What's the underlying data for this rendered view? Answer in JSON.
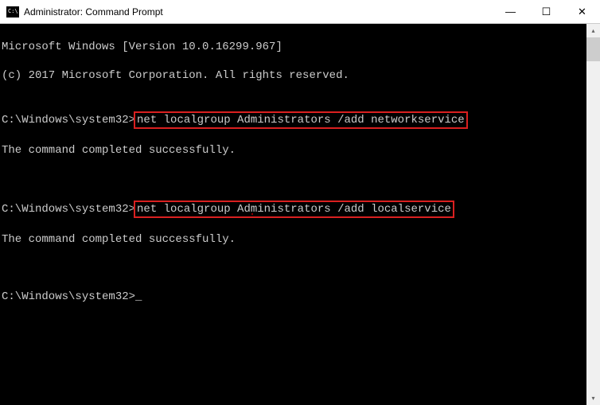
{
  "window": {
    "title": "Administrator: Command Prompt"
  },
  "terminal": {
    "line1": "Microsoft Windows [Version 10.0.16299.967]",
    "line2": "(c) 2017 Microsoft Corporation. All rights reserved.",
    "blank1": "",
    "prompt1_prefix": "C:\\Windows\\system32>",
    "cmd1": "net localgroup Administrators /add networkservice",
    "result1": "The command completed successfully.",
    "blank2": "",
    "blank3": "",
    "prompt2_prefix": "C:\\Windows\\system32>",
    "cmd2": "net localgroup Administrators /add localservice",
    "result2": "The command completed successfully.",
    "blank4": "",
    "blank5": "",
    "prompt3": "C:\\Windows\\system32>",
    "cursor": "_"
  },
  "controls": {
    "minimize": "—",
    "maximize": "☐",
    "close": "✕"
  },
  "scroll": {
    "up": "▴",
    "down": "▾"
  }
}
